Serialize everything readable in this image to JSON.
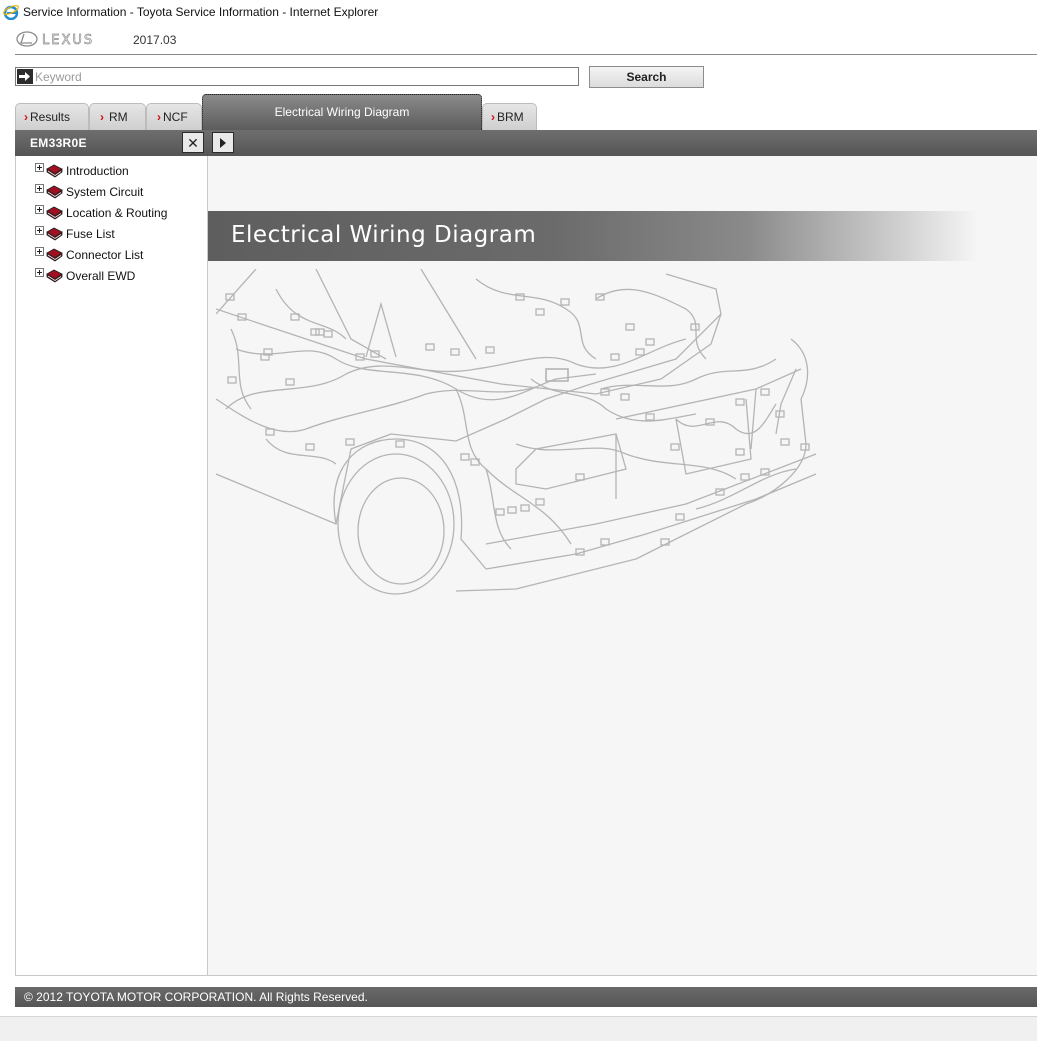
{
  "window": {
    "title": "Service Information - Toyota Service Information - Internet Explorer"
  },
  "header": {
    "logo_text": "LEXUS",
    "version": "2017.03"
  },
  "search": {
    "placeholder": "Keyword",
    "value": "",
    "button_label": "Search"
  },
  "tabs": [
    {
      "label": "Results",
      "active": false
    },
    {
      "label": "RM",
      "active": false
    },
    {
      "label": "NCF",
      "active": false
    },
    {
      "label": "Electrical Wiring Diagram",
      "active": true
    },
    {
      "label": "BRM",
      "active": false
    }
  ],
  "panel": {
    "doc_id": "EM33R0E",
    "close_label": "✕"
  },
  "tree": [
    {
      "label": "Introduction",
      "icon": "book-icon"
    },
    {
      "label": "System Circuit",
      "icon": "book-icon"
    },
    {
      "label": "Location & Routing",
      "icon": "book-icon"
    },
    {
      "label": "Fuse List",
      "icon": "book-icon"
    },
    {
      "label": "Connector List",
      "icon": "book-icon"
    },
    {
      "label": "Overall EWD",
      "icon": "book-icon"
    }
  ],
  "content": {
    "banner_title": "Electrical Wiring Diagram",
    "illustration": "vehicle-wiring-harness-illustration"
  },
  "footer": {
    "copyright": "© 2012 TOYOTA MOTOR CORPORATION. All Rights Reserved."
  },
  "colors": {
    "dark_bar": "#5f5f5f",
    "content_bg": "#f5f6f5",
    "tab_chevron": "#cc1010",
    "book_icon": "#a01020"
  }
}
